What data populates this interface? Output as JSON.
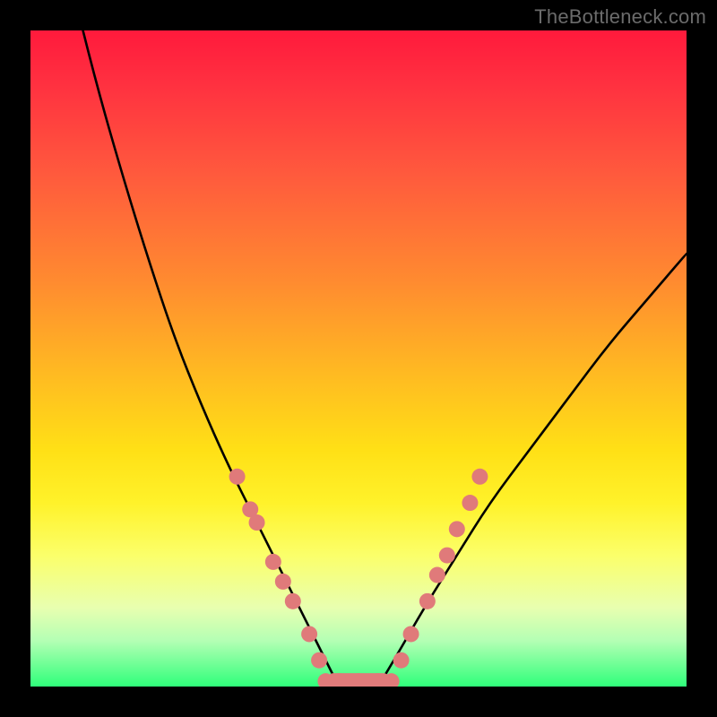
{
  "watermark": "TheBottleneck.com",
  "chart_data": {
    "type": "line",
    "title": "",
    "xlabel": "",
    "ylabel": "",
    "xlim": [
      0,
      100
    ],
    "ylim": [
      0,
      100
    ],
    "series": [
      {
        "name": "left-curve",
        "x": [
          8,
          10,
          14,
          18,
          22,
          26,
          30,
          34,
          38,
          42,
          45,
          47
        ],
        "y": [
          100,
          92,
          78,
          65,
          53,
          43,
          34,
          26,
          18,
          10,
          4,
          0
        ]
      },
      {
        "name": "right-curve",
        "x": [
          53,
          56,
          60,
          65,
          70,
          76,
          82,
          88,
          94,
          100
        ],
        "y": [
          0,
          5,
          12,
          20,
          28,
          36,
          44,
          52,
          59,
          66
        ]
      },
      {
        "name": "bottom-flat",
        "x": [
          45,
          55
        ],
        "y": [
          0,
          0
        ]
      }
    ],
    "markers": {
      "name": "data-points",
      "color": "#e07a7a",
      "radius_px": 9,
      "points": [
        {
          "x": 31.5,
          "y": 32
        },
        {
          "x": 33.5,
          "y": 27
        },
        {
          "x": 34.5,
          "y": 25
        },
        {
          "x": 37,
          "y": 19
        },
        {
          "x": 38.5,
          "y": 16
        },
        {
          "x": 40,
          "y": 13
        },
        {
          "x": 42.5,
          "y": 8
        },
        {
          "x": 44,
          "y": 4
        },
        {
          "x": 45,
          "y": 0.8
        },
        {
          "x": 47,
          "y": 0.8
        },
        {
          "x": 50,
          "y": 0.8
        },
        {
          "x": 53,
          "y": 0.8
        },
        {
          "x": 55,
          "y": 0.8
        },
        {
          "x": 56.5,
          "y": 4
        },
        {
          "x": 58,
          "y": 8
        },
        {
          "x": 60.5,
          "y": 13
        },
        {
          "x": 62,
          "y": 17
        },
        {
          "x": 63.5,
          "y": 20
        },
        {
          "x": 65,
          "y": 24
        },
        {
          "x": 67,
          "y": 28
        },
        {
          "x": 68.5,
          "y": 32
        }
      ]
    },
    "background_gradient": {
      "top": "#ff1a3c",
      "mid_upper": "#ff8a30",
      "mid": "#ffe016",
      "mid_lower": "#fbff6a",
      "bottom": "#2fff7a"
    }
  }
}
